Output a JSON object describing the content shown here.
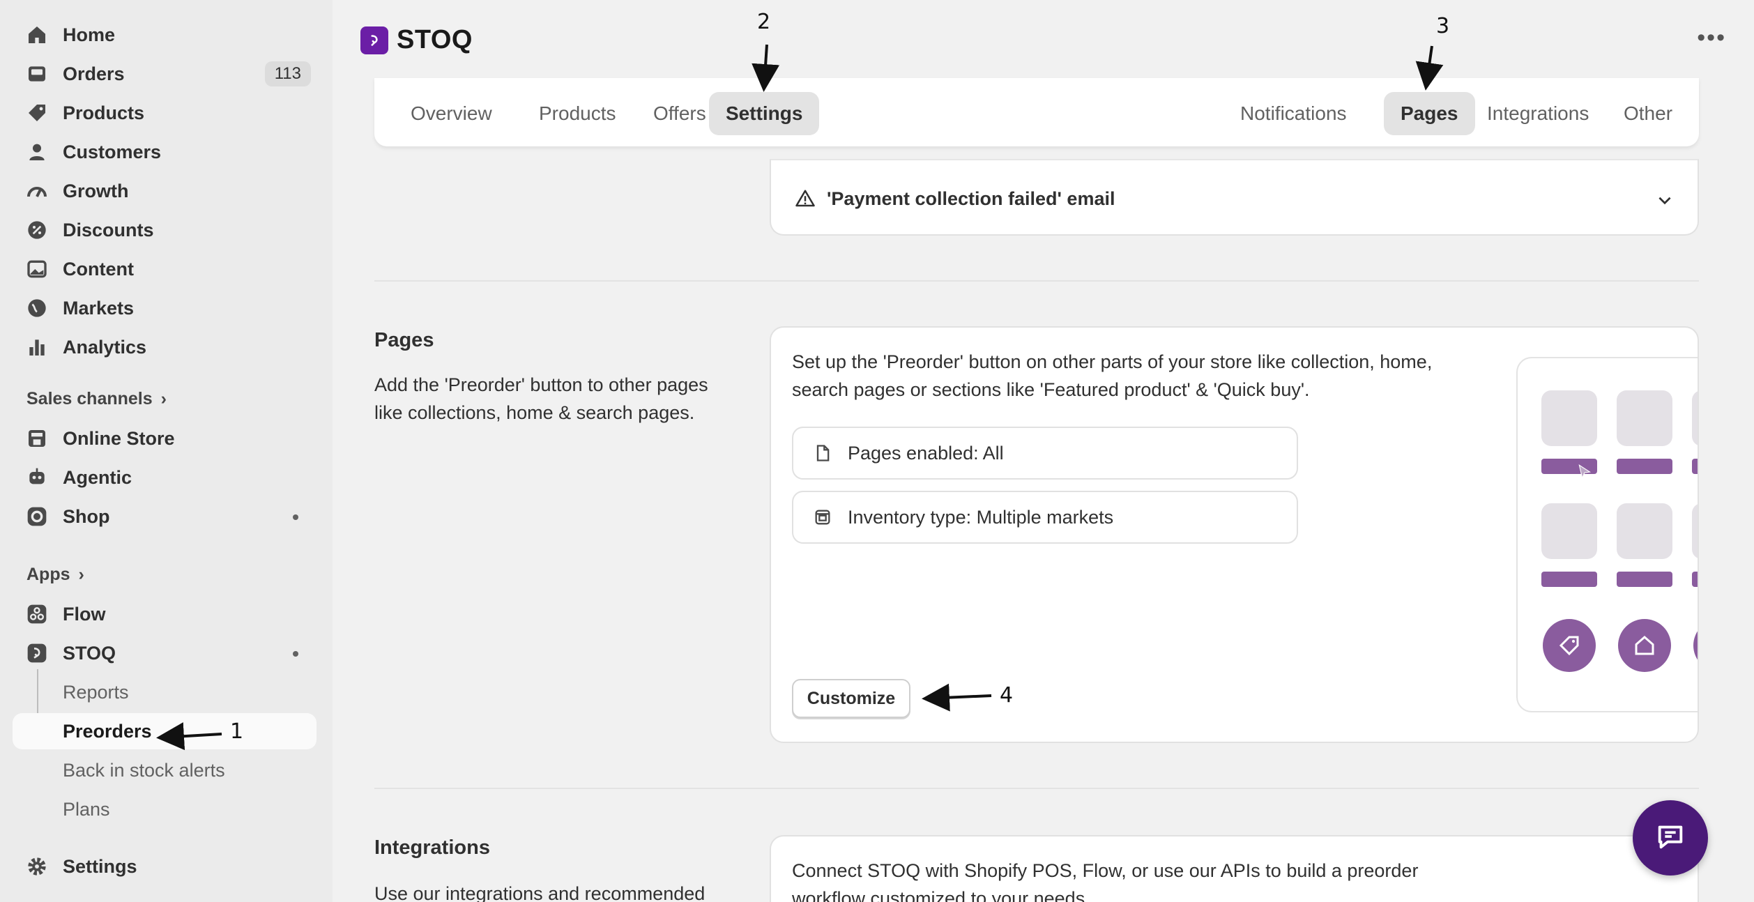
{
  "sidebar": {
    "items": [
      {
        "label": "Home"
      },
      {
        "label": "Orders",
        "badge": "113"
      },
      {
        "label": "Products"
      },
      {
        "label": "Customers"
      },
      {
        "label": "Growth"
      },
      {
        "label": "Discounts"
      },
      {
        "label": "Content"
      },
      {
        "label": "Markets"
      },
      {
        "label": "Analytics"
      }
    ],
    "sales_channels_label": "Sales channels",
    "channels": [
      {
        "label": "Online Store"
      },
      {
        "label": "Agentic"
      },
      {
        "label": "Shop"
      }
    ],
    "apps_label": "Apps",
    "apps": [
      {
        "label": "Flow"
      },
      {
        "label": "STOQ"
      }
    ],
    "stoq_sub": [
      {
        "label": "Reports"
      },
      {
        "label": "Preorders"
      },
      {
        "label": "Back in stock alerts"
      },
      {
        "label": "Plans"
      }
    ],
    "settings_label": "Settings"
  },
  "header": {
    "app_name": "STOQ",
    "more_label": "•••"
  },
  "tabs": {
    "left": [
      "Overview",
      "Products",
      "Offers",
      "Settings"
    ],
    "right": [
      "Notifications",
      "Pages",
      "Integrations",
      "Other"
    ],
    "selected_left": "Settings",
    "selected_right": "Pages"
  },
  "email_card": {
    "title": "'Payment collection failed' email"
  },
  "pages_section": {
    "title": "Pages",
    "description": "Add the 'Preorder' button to other pages like collections, home & search pages.",
    "card_text_line1": "Set up the 'Preorder' button on other parts of your store like collection, home,",
    "card_text_line2": "search pages or sections like 'Featured product' & 'Quick buy'.",
    "pages_enabled": "Pages enabled: All",
    "inventory_type": "Inventory type: Multiple markets",
    "customize_label": "Customize"
  },
  "integrations_section": {
    "title": "Integrations",
    "description": "Use our integrations and recommended",
    "card_text_line1": "Connect STOQ with Shopify POS, Flow, or use our APIs to build a preorder",
    "card_text_line2": "workflow customized to your needs."
  },
  "annotations": [
    "1",
    "2",
    "3",
    "4"
  ],
  "colors": {
    "brand": "#6b1ea6",
    "illustration_accent": "#8a5c9e",
    "chat_button": "#4a1a78"
  }
}
